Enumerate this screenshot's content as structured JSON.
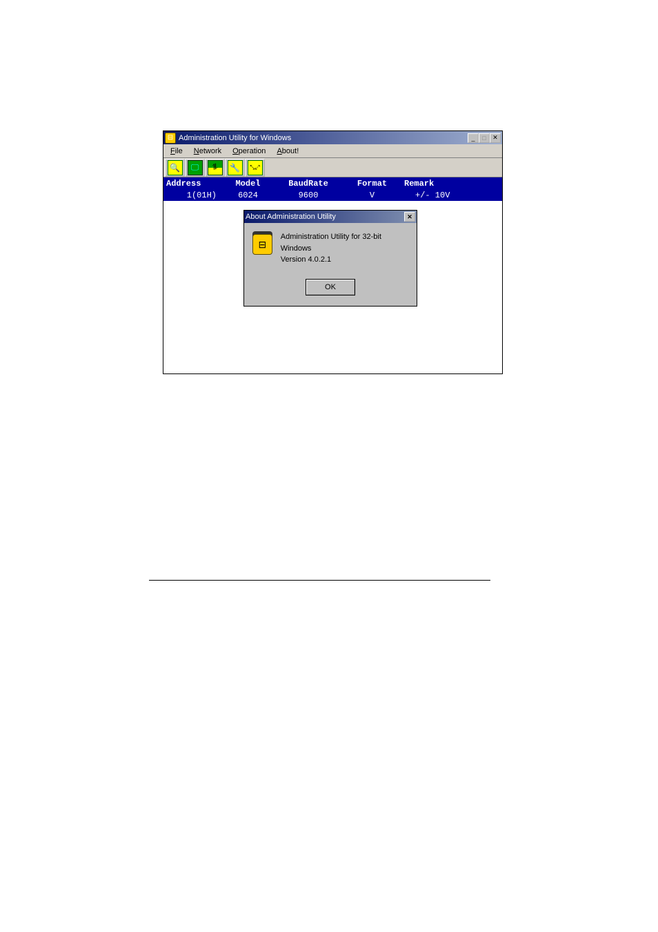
{
  "window": {
    "title": "Administration Utility for Windows"
  },
  "menu": {
    "file": "File",
    "network": "Network",
    "operation": "Operation",
    "about": "About!"
  },
  "table": {
    "headers": {
      "address": "Address",
      "model": "Model",
      "baud": "BaudRate",
      "format": "Format",
      "remark": "Remark"
    },
    "rows": [
      {
        "address": "1(01H)",
        "model": "6024",
        "baud": "9600",
        "format": "V",
        "remark": "+/- 10V"
      }
    ]
  },
  "about_dialog": {
    "title": "About  Administration Utility",
    "line1": "Administration Utility for 32-bit Windows",
    "line2": "Version 4.0.2.1",
    "ok": "OK"
  }
}
